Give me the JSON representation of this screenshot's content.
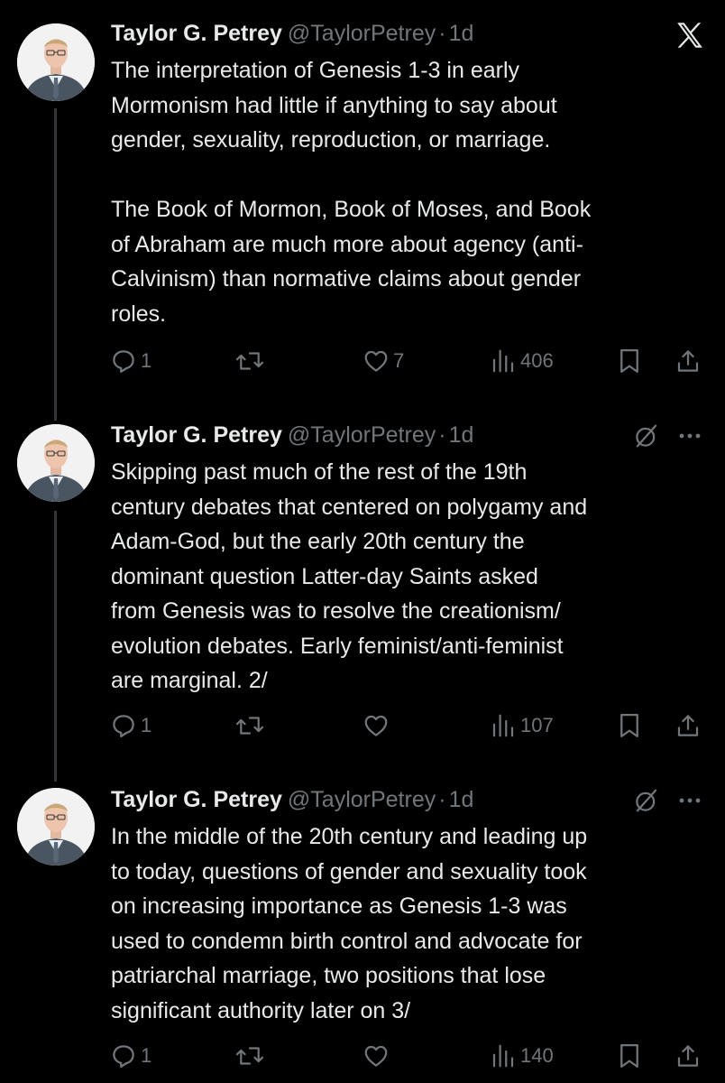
{
  "tweets": [
    {
      "name": "Taylor G. Petrey",
      "handle": "@TaylorPetrey",
      "separator": "·",
      "time": "1d",
      "text": "The interpretation of Genesis 1-3 in early\nMormonism had little if anything to say about\ngender, sexuality, reproduction, or marriage.\n\nThe Book of Mormon, Book of Moses, and Book\nof Abraham are much more about agency (anti-\nCalvinism) than normative claims about gender\nroles.",
      "replies": "1",
      "retweets": "",
      "likes": "7",
      "views": "406",
      "top_icon": "x-logo-icon"
    },
    {
      "name": "Taylor G. Petrey",
      "handle": "@TaylorPetrey",
      "separator": "·",
      "time": "1d",
      "text": "Skipping past much of the rest of the 19th\ncentury debates that centered on polygamy and\nAdam-God, but the early 20th century the\ndominant question Latter-day Saints asked\nfrom Genesis was to resolve the creationism/\nevolution debates. Early feminist/anti-feminist\nare marginal. 2/",
      "replies": "1",
      "retweets": "",
      "likes": "",
      "views": "107",
      "top_icon": "grok-icon"
    },
    {
      "name": "Taylor G. Petrey",
      "handle": "@TaylorPetrey",
      "separator": "·",
      "time": "1d",
      "text": "In the middle of the 20th century and leading up\nto today, questions of gender and sexuality took\non increasing importance as Genesis 1-3 was\nused to condemn birth control and advocate for\npatriarchal marriage, two positions that lose\nsignificant authority later on 3/",
      "replies": "1",
      "retweets": "",
      "likes": "",
      "views": "140",
      "top_icon": "grok-icon"
    }
  ],
  "icons": {
    "reply": "reply-icon",
    "retweet": "retweet-icon",
    "like": "heart-icon",
    "views": "views-icon",
    "bookmark": "bookmark-icon",
    "share": "share-icon",
    "more": "more-icon"
  },
  "colors": {
    "background": "#000000",
    "text": "#e7e9ea",
    "secondary": "#71767b",
    "thread_line": "#333639"
  }
}
